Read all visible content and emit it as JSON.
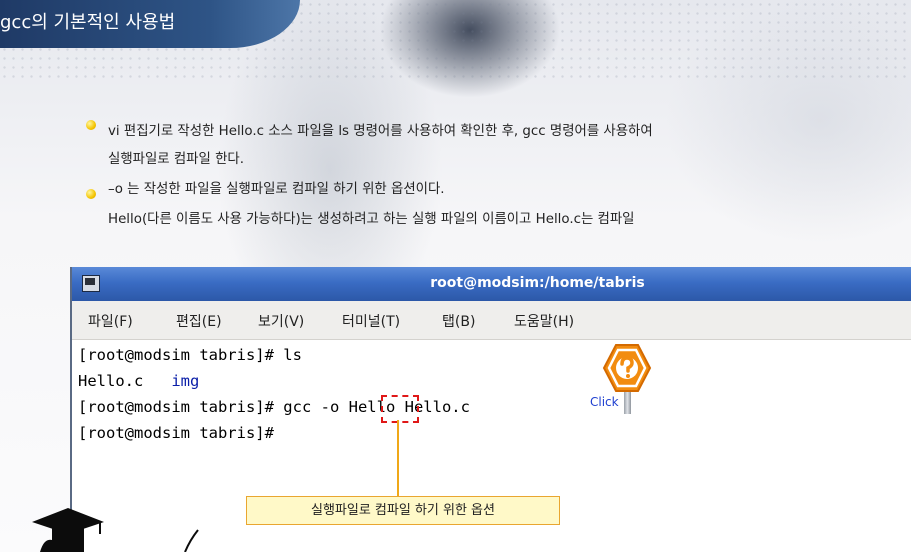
{
  "slide": {
    "title": "gcc의 기본적인 사용법",
    "bullets": [
      "vi 편집기로 작성한 Hello.c 소스 파일을 ls 명령어를 사용하여 확인한 후, gcc 명령어를 사용하여",
      "실행파일로 컴파일 한다.",
      "–o 는 작성한 파일을 실행파일로 컴파일 하기 위한 옵션이다.",
      "Hello(다른 이름도 사용 가능하다)는 생성하려고 하는 실행 파일의 이름이고 Hello.c는 컴파일"
    ]
  },
  "terminal": {
    "window_title": "root@modsim:/home/tabris",
    "menu": [
      "파일(F)",
      "편집(E)",
      "보기(V)",
      "터미널(T)",
      "탭(B)",
      "도움말(H)"
    ],
    "lines": {
      "l1": "[root@modsim tabris]# ls",
      "l2_file": "Hello.c",
      "l2_dir": "img",
      "l3_prefix": "[root@modsim tabris]# gcc ",
      "l3_option": "-o",
      "l3_suffix": " Hello Hello.c",
      "l4": "[root@modsim tabris]#"
    }
  },
  "help_sign": {
    "label": "Click"
  },
  "callout": {
    "text": "실행파일로 컴파일 하기 위한 옵션"
  },
  "colors": {
    "titlebar": "#3a6cc4",
    "option_box": "#e01818",
    "callout_border": "#e9a630",
    "sign": "#f28c0f",
    "bullet": "#f4c400"
  }
}
